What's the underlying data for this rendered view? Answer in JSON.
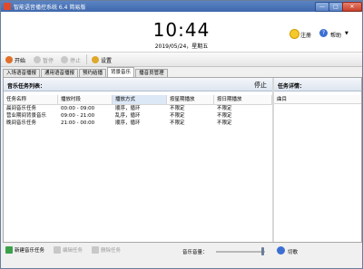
{
  "window": {
    "title": "智能语音播控系统 6.4 简易版",
    "min_label": "—",
    "max_label": "□",
    "close_label": "✕"
  },
  "clock": {
    "time": "10:44",
    "date": "2019/05/24，星期五"
  },
  "top_links": {
    "register": "注册",
    "help": "帮助",
    "menu_arrow": "▼"
  },
  "toolbar": {
    "start": "开始",
    "pause": "暂停",
    "stop": "停止",
    "settings": "设置"
  },
  "tabs": [
    "入场语音播报",
    "通用语音播报",
    "预约结播",
    "背景音乐",
    "播音员管理"
  ],
  "active_tab": 3,
  "list": {
    "title": "音乐任务列表：",
    "state": "停止",
    "columns": [
      "任务名称",
      "播放时段",
      "播放方式",
      "按星期播放",
      "按日期播放"
    ],
    "rows": [
      [
        "晨间音乐任务",
        "00:00 - 09:00",
        "顺序，循环",
        "不限定",
        "不限定"
      ],
      [
        "营业期间背景音乐",
        "09:00 - 21:00",
        "乱序，循环",
        "不限定",
        "不限定"
      ],
      [
        "晚间音乐任务",
        "21:00 - 00:00",
        "顺序，循环",
        "不限定",
        "不限定"
      ]
    ]
  },
  "details": {
    "title": "任务详情：",
    "column": "曲目"
  },
  "footer": {
    "new_task": "新建音乐任务",
    "edit_task": "编辑任务",
    "delete_task": "删除任务",
    "volume_label": "音乐音量：",
    "volume": 0.95,
    "switch": "切歌"
  },
  "colors": {
    "titlebar": "#4a72b8",
    "accent": "#3b6fd3",
    "smile": "#f6c92a"
  },
  "icons": [
    "app-logo-icon",
    "smile-icon",
    "help-icon",
    "play-icon",
    "pause-icon",
    "stop-icon",
    "settings-icon",
    "music-add-icon",
    "edit-icon",
    "delete-icon",
    "switch-icon"
  ]
}
